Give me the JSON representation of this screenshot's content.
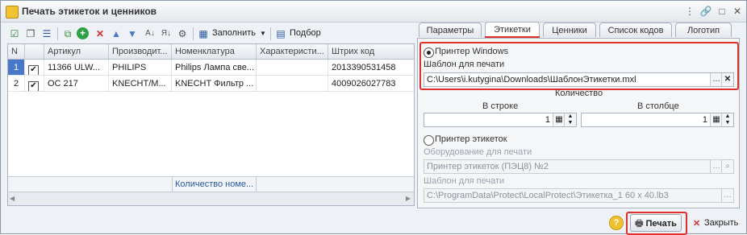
{
  "window": {
    "title": "Печать этикеток и ценников"
  },
  "toolbar": {
    "fill_label": "Заполнить",
    "select_label": "Подбор"
  },
  "grid": {
    "headers": [
      "N",
      "",
      "Артикул",
      "Производит...",
      "Номенклатура",
      "Характеристи...",
      "Штрих код"
    ],
    "rows": [
      {
        "n": "1",
        "checked": "✔",
        "article": "11366 ULW...",
        "maker": "PHILIPS",
        "nomenclature": "Philips Лампа све...",
        "characteristic": "",
        "barcode": "2013390531458"
      },
      {
        "n": "2",
        "checked": "✔",
        "article": "OC 217",
        "maker": "KNECHT/M...",
        "nomenclature": "KNECHT Фильтр ...",
        "characteristic": "",
        "barcode": "4009026027783"
      }
    ],
    "footer": "Количество номе..."
  },
  "tabs": [
    "Параметры",
    "Этикетки",
    "Ценники",
    "Список кодов",
    "Логотип"
  ],
  "active_tab": "Этикетки",
  "labels_tab": {
    "printer_windows_label": "Принтер Windows",
    "template_label": "Шаблон для печати",
    "template_value": "C:\\Users\\i.kutygina\\Downloads\\ШаблонЭтикетки.mxl",
    "quantity_label": "Количество",
    "in_row_label": "В строке",
    "in_row_value": "1",
    "in_column_label": "В столбце",
    "in_column_value": "1",
    "label_printer_label": "Принтер этикеток",
    "equipment_label": "Оборудование для печати",
    "equipment_value": "Принтер этикеток (ПЭЦ8) №2",
    "template2_label": "Шаблон для печати",
    "template2_value": "C:\\ProgramData\\Protect\\LocalProtect\\Этикетка_1 60 x 40.lb3"
  },
  "buttons": {
    "help": "?",
    "print": "Печать",
    "close": "Закрыть"
  },
  "colors": {
    "highlight": "#e0302c",
    "selection": "#4a78c8"
  }
}
